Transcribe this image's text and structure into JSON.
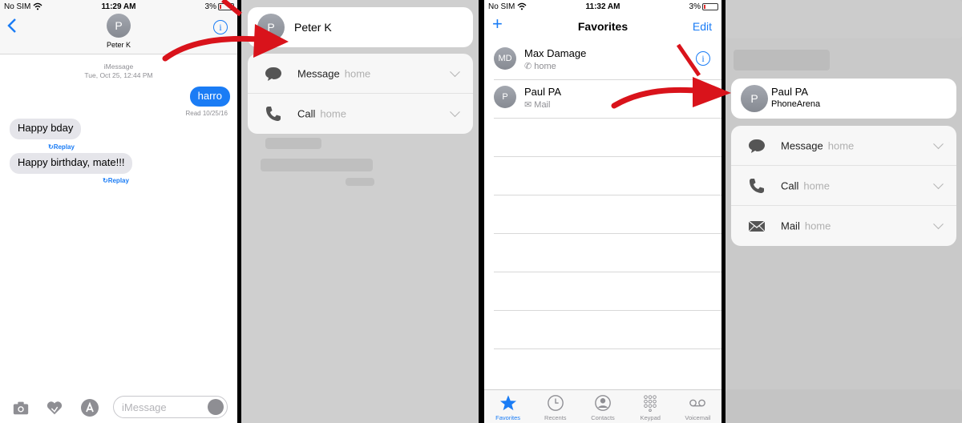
{
  "panel1": {
    "status": {
      "carrier": "No SIM",
      "time": "11:29 AM",
      "battery": "3%"
    },
    "contact": {
      "initial": "P",
      "name": "Peter K"
    },
    "service": "iMessage",
    "date": "Tue, Oct 25, 12:44 PM",
    "sent": "harro",
    "read": "Read 10/25/16",
    "received": [
      "Happy bday",
      "Happy birthday, mate!!!"
    ],
    "replay_label": "Replay",
    "input_placeholder": "iMessage"
  },
  "panel2": {
    "contact": {
      "initial": "P",
      "name": "Peter K"
    },
    "actions": [
      {
        "label": "Message",
        "sub": "home",
        "icon": "speech-bubble-icon"
      },
      {
        "label": "Call",
        "sub": "home",
        "icon": "phone-icon"
      }
    ]
  },
  "panel3": {
    "status": {
      "carrier": "No SIM",
      "time": "11:32 AM",
      "battery": "3%"
    },
    "title": "Favorites",
    "add": "+",
    "edit": "Edit",
    "favorites": [
      {
        "initials": "MD",
        "name": "Max Damage",
        "sub": "home",
        "sub_icon": "phone-icon"
      },
      {
        "initials": "P",
        "name": "Paul PA",
        "sub": "Mail",
        "sub_icon": "mail-icon"
      }
    ],
    "tabs": [
      {
        "label": "Favorites",
        "icon": "star-icon",
        "active": true
      },
      {
        "label": "Recents",
        "icon": "clock-icon"
      },
      {
        "label": "Contacts",
        "icon": "person-icon"
      },
      {
        "label": "Keypad",
        "icon": "keypad-icon"
      },
      {
        "label": "Voicemail",
        "icon": "voicemail-icon"
      }
    ]
  },
  "panel4": {
    "contact": {
      "initial": "P",
      "name": "Paul PA",
      "company": "PhoneArena"
    },
    "actions": [
      {
        "label": "Message",
        "sub": "home",
        "icon": "speech-bubble-icon"
      },
      {
        "label": "Call",
        "sub": "home",
        "icon": "phone-icon"
      },
      {
        "label": "Mail",
        "sub": "home",
        "icon": "mail-icon"
      }
    ]
  },
  "colors": {
    "accent": "#1a7cf5",
    "arrow": "#d9131b",
    "bubble_received": "#e5e5ea"
  }
}
